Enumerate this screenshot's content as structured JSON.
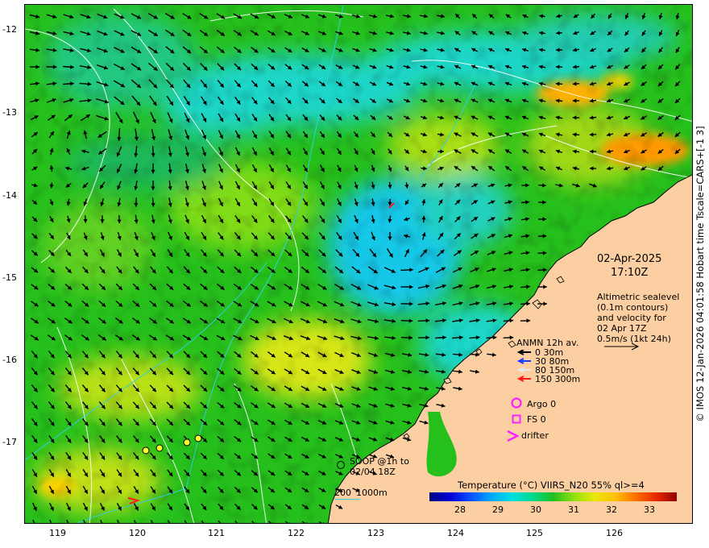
{
  "map": {
    "y_ticks": [
      "-12",
      "-13",
      "-14",
      "-15",
      "-16",
      "-17"
    ],
    "x_ticks": [
      "119",
      "120",
      "121",
      "122",
      "123",
      "124",
      "125",
      "126"
    ],
    "lat_range": [
      -17.95,
      -11.7
    ],
    "lon_range": [
      118.6,
      126.95
    ],
    "colors": {
      "land": "#fbcfa2",
      "ocean_warm_green": "#26c01c",
      "ocean_cool_cyan": "#1ed6c8",
      "vector": "#000000",
      "contour": "#ffffff",
      "isobath": "#2fd0e0"
    }
  },
  "overlay": {
    "date": "02-Apr-2025",
    "time": "17:10Z",
    "altimetry": [
      "Altimetric sealevel",
      "(0.1m contours)",
      "and velocity for",
      "02 Apr 17Z",
      "0.5m/s (1kt 24h)"
    ],
    "anmn": {
      "title": "ANMN 12h av.",
      "items": [
        {
          "label": "0 30m",
          "color": "#000000"
        },
        {
          "label": "30 80m",
          "color": "#1a3cff"
        },
        {
          "label": "80 150m",
          "color": "#e8e8e8"
        },
        {
          "label": "150 300m",
          "color": "#ff1a1a"
        }
      ]
    },
    "argo": "Argo 0",
    "fs": "FS 0",
    "drifter": "drifter",
    "soop": [
      "SOOP @1h to",
      "02/04 18Z"
    ],
    "isobath_labels": [
      "200",
      "1000m"
    ],
    "colorbar": {
      "title": "Temperature (°C) VIIRS_N20 55% ql>=4",
      "ticks": [
        "28",
        "29",
        "30",
        "31",
        "32",
        "33"
      ],
      "range": [
        27.4,
        33.75
      ]
    },
    "side_text": "© IMOS 12-Jan-2026 04:01:58 Hobart time Tscale=CARS+[-1 3]"
  }
}
